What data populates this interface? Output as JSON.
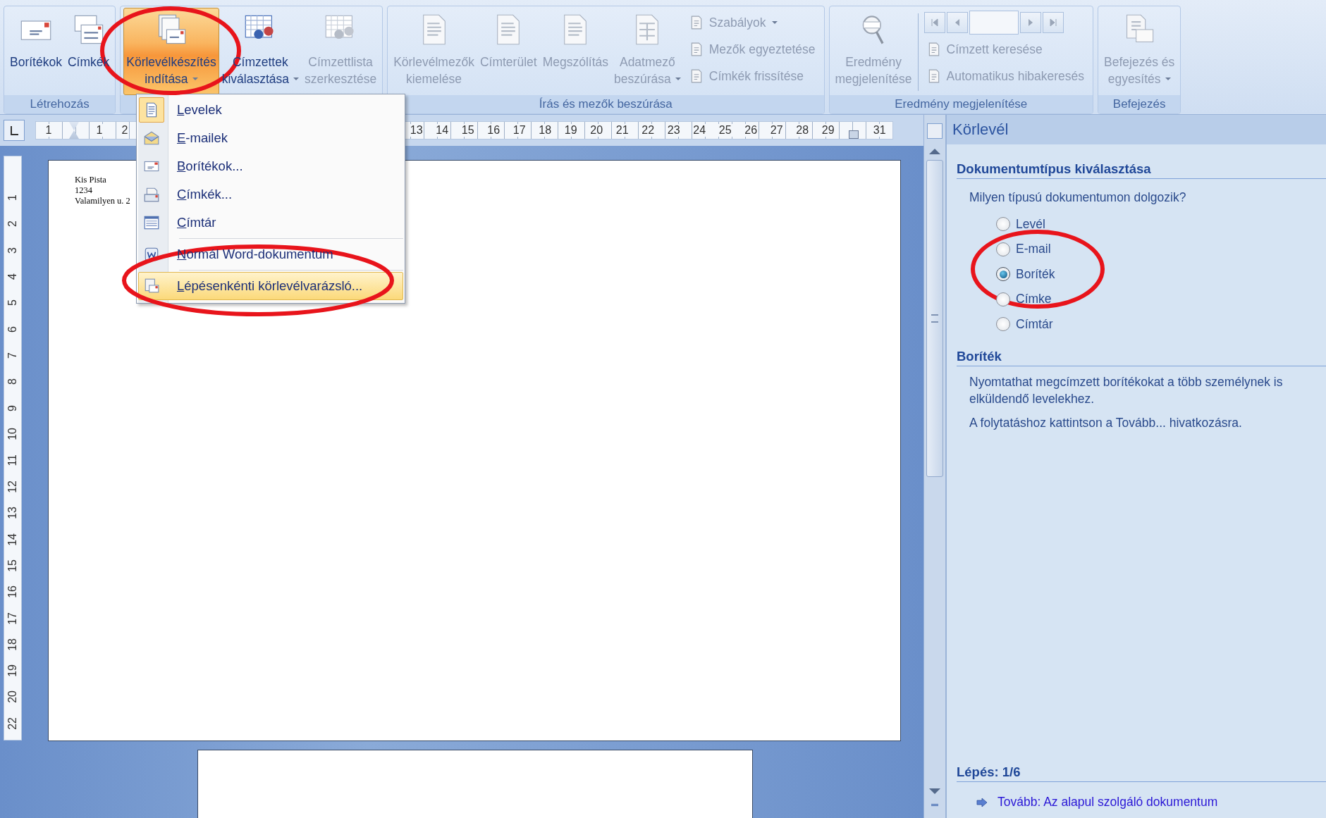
{
  "ribbon": {
    "groups": [
      {
        "label": "Létrehozás",
        "buttons": [
          {
            "lines": [
              "Borítékok"
            ],
            "disabled": false,
            "pressed": false,
            "dropdown": false
          },
          {
            "lines": [
              "Címkék"
            ],
            "disabled": false,
            "pressed": false,
            "dropdown": false
          }
        ]
      },
      {
        "buttons": [
          {
            "lines": [
              "Körlevélkészítés",
              "indítása"
            ],
            "disabled": false,
            "pressed": true,
            "dropdown": true
          },
          {
            "lines": [
              "Címzettek",
              "kiválasztása"
            ],
            "disabled": false,
            "pressed": false,
            "dropdown": true
          },
          {
            "lines": [
              "Címzettlista",
              "szerkesztése"
            ],
            "disabled": true,
            "pressed": false,
            "dropdown": false
          }
        ]
      },
      {
        "label": "Írás és mezők beszúrása",
        "buttons": [
          {
            "lines": [
              "Körlevélmezők",
              "kiemelése"
            ],
            "disabled": true,
            "pressed": false,
            "dropdown": false
          },
          {
            "lines": [
              "Címterület"
            ],
            "disabled": true,
            "pressed": false,
            "dropdown": false
          },
          {
            "lines": [
              "Megszólítás"
            ],
            "disabled": true,
            "pressed": false,
            "dropdown": false
          },
          {
            "lines": [
              "Adatmező",
              "beszúrása"
            ],
            "disabled": true,
            "pressed": false,
            "dropdown": true
          }
        ],
        "small_buttons": [
          {
            "label": "Szabályok",
            "disabled": true,
            "dropdown": true
          },
          {
            "label": "Mezők egyeztetése",
            "disabled": true,
            "dropdown": false
          },
          {
            "label": "Címkék frissítése",
            "disabled": true,
            "dropdown": false
          }
        ]
      },
      {
        "label": "Eredmény megjelenítése",
        "buttons": [
          {
            "lines": [
              "Eredmény",
              "megjelenítése"
            ],
            "disabled": true,
            "pressed": false,
            "dropdown": false
          }
        ],
        "record_navigation": true,
        "small_buttons": [
          {
            "label": "Címzett keresése",
            "disabled": true,
            "dropdown": false
          },
          {
            "label": "Automatikus hibakeresés",
            "disabled": true,
            "dropdown": false
          }
        ]
      },
      {
        "label": "Befejezés",
        "buttons": [
          {
            "lines": [
              "Befejezés és",
              "egyesítés"
            ],
            "disabled": true,
            "pressed": false,
            "dropdown": true
          }
        ]
      }
    ]
  },
  "menu": {
    "items": [
      {
        "label": "Levelek",
        "checked": true,
        "selected": false,
        "separator_before": false
      },
      {
        "label": "E-mailek",
        "checked": false,
        "selected": false,
        "separator_before": false
      },
      {
        "label": "Borítékok...",
        "checked": false,
        "selected": false,
        "separator_before": false
      },
      {
        "label": "Címkék...",
        "checked": false,
        "selected": false,
        "separator_before": false
      },
      {
        "label": "Címtár",
        "checked": false,
        "selected": false,
        "separator_before": false
      },
      {
        "label": "Normál Word-dokumentum",
        "checked": false,
        "selected": false,
        "separator_before": true
      },
      {
        "label": "Lépésenkénti körlevélvarázsló...",
        "checked": false,
        "selected": true,
        "separator_before": true
      }
    ]
  },
  "ruler": {
    "left_numbers": [
      "1",
      "1",
      "2"
    ],
    "right_numbers": [
      "13",
      "14",
      "15",
      "16",
      "17",
      "18",
      "19",
      "20",
      "21",
      "22",
      "23",
      "24",
      "25",
      "26",
      "27",
      "28",
      "29",
      "31"
    ],
    "vertical_numbers": [
      "1",
      "2",
      "3",
      "4",
      "5",
      "6",
      "7",
      "8",
      "9",
      "10",
      "11",
      "12",
      "13",
      "14",
      "15",
      "16",
      "17",
      "18",
      "19",
      "20",
      "22"
    ]
  },
  "document": {
    "lines": [
      "Kis Pista",
      "1234",
      "Valamilyen u. 2"
    ]
  },
  "task_pane": {
    "title": "Körlevél",
    "section_heading": "Dokumentumtípus kiválasztása",
    "question": "Milyen típusú dokumentumon dolgozik?",
    "options": [
      {
        "label": "Levél",
        "selected": false
      },
      {
        "label": "E-mail",
        "selected": false
      },
      {
        "label": "Boríték",
        "selected": true
      },
      {
        "label": "Címke",
        "selected": false
      },
      {
        "label": "Címtár",
        "selected": false
      }
    ],
    "description_heading": "Boríték",
    "paragraphs": [
      "Nyomtathat megcímzett borítékokat a több személynek is elküldendő levelekhez.",
      "A folytatáshoz kattintson a Tovább... hivatkozásra."
    ],
    "step": "Lépés: 1/6",
    "next_link": "Tovább: Az alapul szolgáló dokumentum"
  }
}
